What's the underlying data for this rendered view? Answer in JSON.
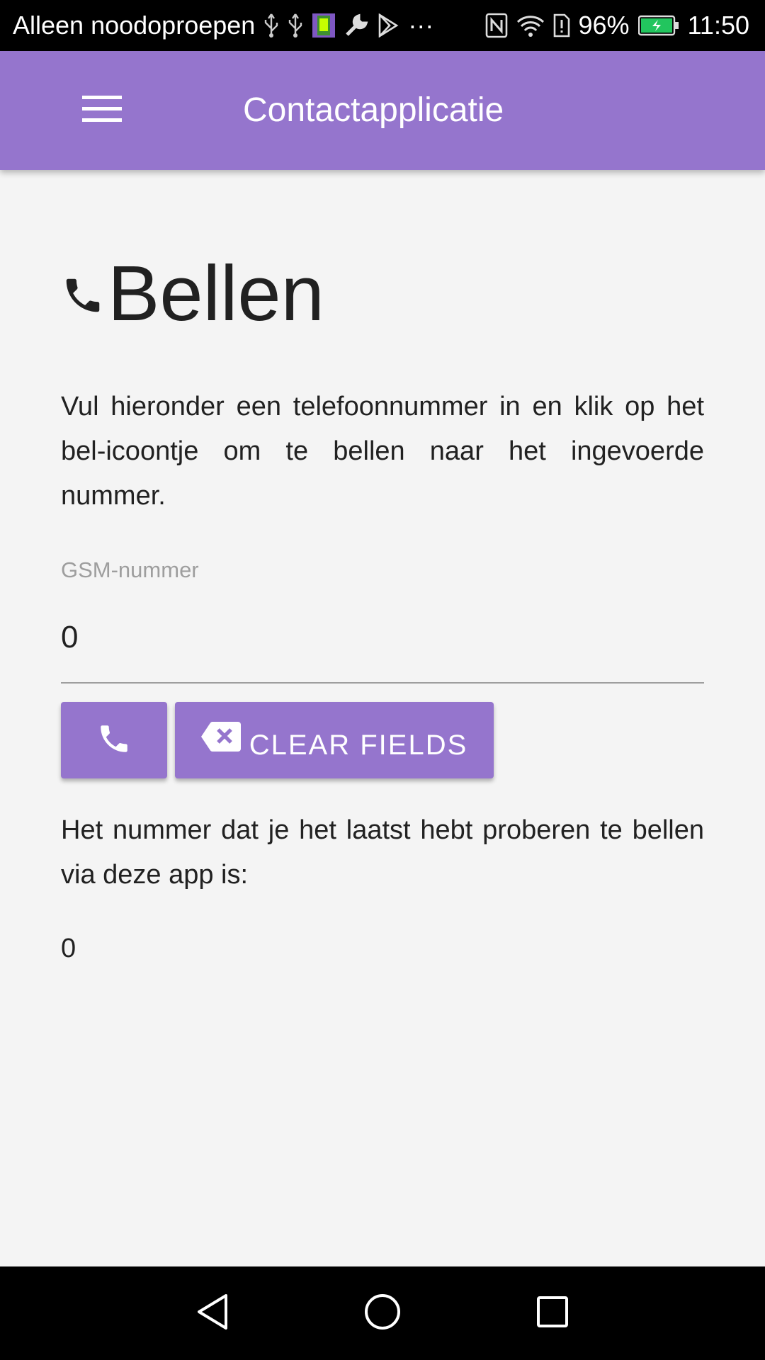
{
  "status_bar": {
    "carrier_text": "Alleen noodoproepen",
    "battery_percent": "96%",
    "time": "11:50",
    "overflow": "···",
    "icons": [
      "usb-icon",
      "usb-icon",
      "app-notification-icon",
      "wrench-icon",
      "play-store-icon",
      "nfc-icon",
      "wifi-icon",
      "sim-alert-icon",
      "battery-charging-icon"
    ]
  },
  "app_bar": {
    "title": "Contactapplicatie",
    "menu_icon": "hamburger-menu-icon",
    "color": "#9575cd"
  },
  "page": {
    "title": "Bellen",
    "title_icon": "phone-icon",
    "intro": "Vul hieronder een telefoonnummer in en klik op het bel-icoontje om te bellen naar het ingevoerde nummer.",
    "phone_field": {
      "label": "GSM-nummer",
      "value": "0"
    },
    "buttons": {
      "call_icon": "phone-icon",
      "clear_icon": "backspace-icon",
      "clear_label": "CLEAR FIELDS"
    },
    "last_number_text": "Het nummer dat je het laatst hebt proberen te bellen via deze app is:",
    "last_number": "0"
  },
  "nav_bar": {
    "back_icon": "back-triangle-icon",
    "home_icon": "home-circle-icon",
    "recent_icon": "recent-apps-square-icon"
  },
  "colors": {
    "accent": "#9575cd",
    "background": "#f4f4f4",
    "text": "#212121",
    "label": "#9e9e9e"
  }
}
